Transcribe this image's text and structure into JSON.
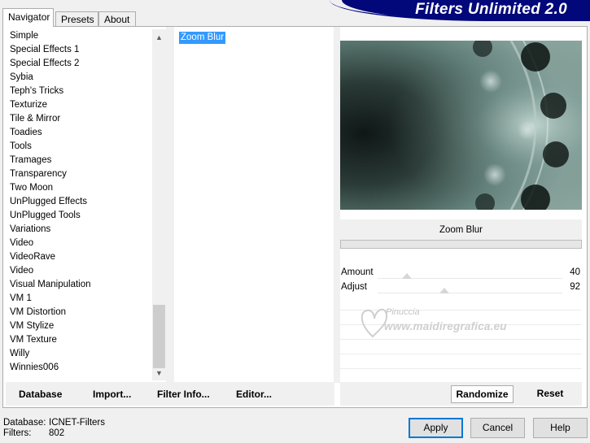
{
  "tabs": [
    {
      "label": "Navigator",
      "active": true
    },
    {
      "label": "Presets",
      "active": false
    },
    {
      "label": "About",
      "active": false
    }
  ],
  "app_title": "Filters Unlimited 2.0",
  "categories": [
    "Simple",
    "Special Effects 1",
    "Special Effects 2",
    "Sybia",
    "Teph's Tricks",
    "Texturize",
    "Tile & Mirror",
    "Toadies",
    "Tools",
    "Tramages",
    "Transparency",
    "Two Moon",
    "UnPlugged Effects",
    "UnPlugged Tools",
    "Variations",
    "Video",
    "VideoRave",
    "Video",
    "Visual Manipulation",
    "VM 1",
    "VM Distortion",
    "VM Stylize",
    "VM Texture",
    "Willy",
    "Winnies006"
  ],
  "selected_category": "VM Stylize",
  "filters": [
    "Zoom Blur"
  ],
  "selected_filter": "Zoom Blur",
  "filter_name_display": "Zoom Blur",
  "params": [
    {
      "label": "Amount",
      "value": "40",
      "level": 0.157
    },
    {
      "label": "Adjust",
      "value": "92",
      "level": 0.361
    }
  ],
  "watermark": {
    "line1": "Pinuccia",
    "line2": "www.maidiregrafica.eu"
  },
  "left_toolbar": {
    "database": "Database",
    "import": "Import...",
    "filter_info": "Filter Info...",
    "editor": "Editor..."
  },
  "right_toolbar": {
    "randomize": "Randomize",
    "reset": "Reset"
  },
  "status": {
    "database_label": "Database:",
    "database_value": "ICNET-Filters",
    "filters_label": "Filters:",
    "filters_value": "802"
  },
  "dialog_buttons": {
    "apply": "Apply",
    "cancel": "Cancel",
    "help": "Help"
  },
  "colors": {
    "accent": "#3399ff",
    "brand": "#02077a",
    "default_button": "#0078d7"
  }
}
